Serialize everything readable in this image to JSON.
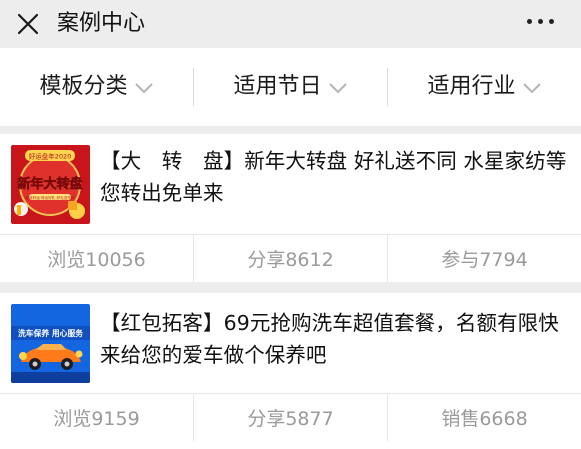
{
  "header": {
    "title": "案例中心",
    "close_icon": "close-icon",
    "more_icon": "more-icon"
  },
  "filters": [
    {
      "label": "模板分类",
      "icon": "chevron-down-icon"
    },
    {
      "label": "适用节日",
      "icon": "chevron-down-icon"
    },
    {
      "label": "适用行业",
      "icon": "chevron-down-icon"
    }
  ],
  "cases": [
    {
      "description": "【大　转　盘】新年大转盘 好礼送不同 水星家纺等您转出免单来",
      "thumbnail": {
        "badge": "好运盘年2020",
        "headline": "新年大转盘",
        "sub": "新年好运 转出好礼 好礼送不停"
      },
      "stats": [
        "浏览10056",
        "分享8612",
        "参与7794"
      ]
    },
    {
      "description": "【红包拓客】69元抢购洗车超值套餐，名额有限快来给您的爱车做个保养吧",
      "thumbnail": {
        "headline": "洗车保养 用心服务"
      },
      "stats": [
        "浏览9159",
        "分享5877",
        "销售6668"
      ]
    }
  ],
  "colors": {
    "background": "#ededed",
    "card": "#ffffff",
    "stat_text": "#9a9a9a",
    "thumb1_red": "#c8151b",
    "thumb2_blue": "#1466e0"
  }
}
